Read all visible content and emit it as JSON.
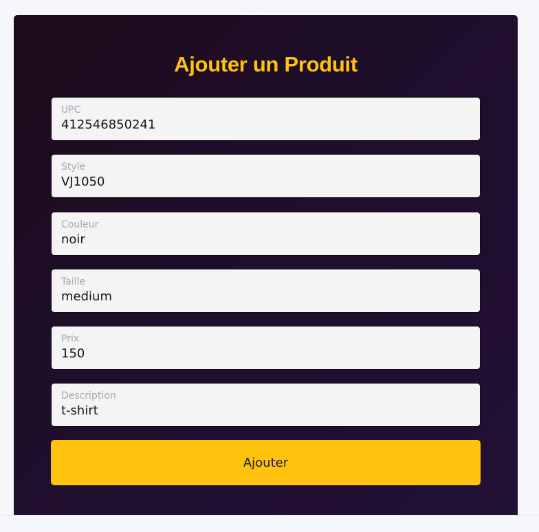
{
  "form": {
    "title": "Ajouter un Produit",
    "fields": [
      {
        "label": "UPC",
        "value": "412546850241"
      },
      {
        "label": "Style",
        "value": "VJ1050"
      },
      {
        "label": "Couleur",
        "value": "noir"
      },
      {
        "label": "Taille",
        "value": "medium"
      },
      {
        "label": "Prix",
        "value": "150"
      },
      {
        "label": "Description",
        "value": "t-shirt"
      }
    ],
    "submit_label": "Ajouter"
  },
  "colors": {
    "accent": "#ffc20e",
    "card_background": "#1f0e2b",
    "field_background": "#f4f4f5",
    "label_text": "#a4a6b3"
  }
}
